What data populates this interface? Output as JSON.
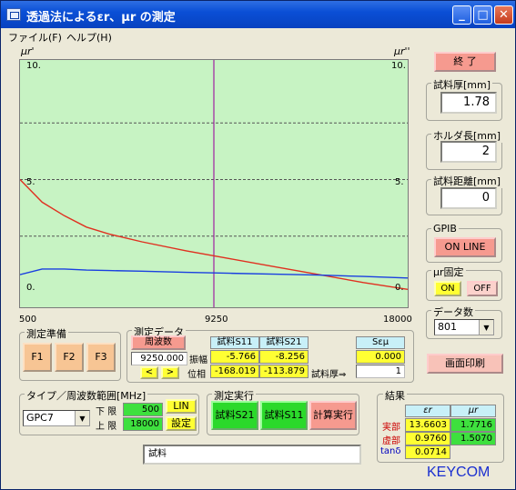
{
  "window": {
    "title": "透過法によるεr、μr の測定",
    "minimize": "_",
    "maximize": "□",
    "close": "✕"
  },
  "menu": [
    {
      "label": "ファイル(F)"
    },
    {
      "label": "ヘルプ(H)"
    }
  ],
  "graph": {
    "left_axis_label": "μr'",
    "right_axis_label": "μr''",
    "left_ticks": [
      "10.",
      "5.",
      "0."
    ],
    "right_ticks": [
      "10.",
      "5.",
      "0."
    ],
    "x_ticks": [
      "500",
      "9250",
      "18000"
    ]
  },
  "chart_data": {
    "type": "line",
    "x": [
      500,
      1500,
      2500,
      3500,
      4500,
      6000,
      8000,
      10000,
      12000,
      14000,
      16000,
      18000
    ],
    "series": [
      {
        "color": "#e03020",
        "values": [
          5.0,
          4.0,
          3.4,
          2.9,
          2.6,
          2.25,
          1.85,
          1.5,
          1.15,
          0.8,
          0.45,
          0.15
        ]
      },
      {
        "color": "#1a3fe0",
        "values": [
          0.8,
          1.05,
          1.05,
          1.0,
          0.98,
          0.95,
          0.9,
          0.86,
          0.82,
          0.78,
          0.72,
          0.65
        ]
      }
    ],
    "xlim": [
      500,
      18000
    ],
    "ylim": [
      0,
      10
    ],
    "cursor_x": 9250,
    "grid_y": [
      2.5,
      5,
      7.5
    ]
  },
  "right_panel": {
    "end_button": "終 了",
    "thickness": {
      "label": "試料厚[mm]",
      "value": "1.78"
    },
    "holder": {
      "label": "ホルダ長[mm]",
      "value": "2"
    },
    "distance": {
      "label": "試料距離[mm]",
      "value": "0"
    },
    "gpib": {
      "label": "GPIB",
      "button": "ON LINE"
    },
    "mu_fixed": {
      "label": "μr固定",
      "on": "ON",
      "off": "OFF"
    },
    "data_count": {
      "label": "データ数",
      "value": "801"
    },
    "print_button": "画面印刷"
  },
  "prep": {
    "label": "測定準備",
    "f1": "F1",
    "f2": "F2",
    "f3": "F3"
  },
  "meas_data": {
    "label": "測定データ",
    "freq_button": "周波数",
    "freq_value": "9250.000",
    "prev": "<",
    "next": ">",
    "col1": "試料S11",
    "col2": "試料S21",
    "amp_label": "振幅",
    "phase_label": "位相",
    "amp_s11": "-5.766",
    "amp_s21": "-8.256",
    "phase_s11": "-168.019",
    "phase_s21": "-113.879",
    "sem_header": "Sεμ",
    "sem_value": "0.000",
    "thick_label": "試料厚⇒",
    "thick_value": "1"
  },
  "type_range": {
    "label": "タイプ／周波数範囲[MHz]",
    "type_value": "GPC7",
    "lower_label": "下 限",
    "upper_label": "上 限",
    "lower_value": "500",
    "upper_value": "18000",
    "lin": "LIN",
    "set": "設定"
  },
  "exec": {
    "label": "測定実行",
    "s21": "試料S21",
    "s11": "試料S11",
    "calc": "計算実行"
  },
  "results": {
    "label": "結果",
    "er": "εr",
    "mr": "μr",
    "real_label": "実部",
    "imag_label": "虚部",
    "tan_label": "tanδ",
    "er_real": "13.6603",
    "mr_real": "1.7716",
    "er_imag": "0.9760",
    "mr_imag": "1.5070",
    "tan": "0.0714"
  },
  "comment": "試料",
  "brand": "KEYCOM"
}
